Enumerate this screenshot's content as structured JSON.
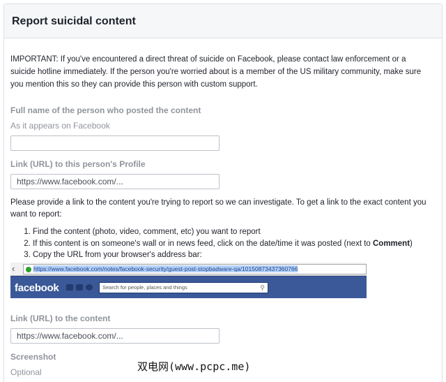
{
  "header": {
    "title": "Report suicidal content"
  },
  "notice": "IMPORTANT: If you've encountered a direct threat of suicide on Facebook, please contact law enforcement or a suicide hotline immediately. If the person you're worried about is a member of the US military community, make sure you mention this so they can provide this person with custom support.",
  "full_name": {
    "label": "Full name of the person who posted the content",
    "sublabel": "As it appears on Facebook",
    "value": "",
    "placeholder": ""
  },
  "profile_link": {
    "label": "Link (URL) to this person's Profile",
    "placeholder": "https://www.facebook.com/..."
  },
  "instructions": {
    "intro": "Please provide a link to the content you're trying to report so we can investigate. To get a link to the exact content you want to report:",
    "steps": [
      "Find the content (photo, video, comment, etc) you want to report",
      "If this content is on someone's wall or in news feed, click on the date/time it was posted (next to ",
      "Copy the URL from your browser's address bar:"
    ],
    "step2_bold": "Comment",
    "step2_end": ")"
  },
  "example_screenshot": {
    "url": "https://www.facebook.com/notes/facebook-security/guest-post-stopbadware-qa/10150873437360766",
    "logo": "facebook",
    "search_placeholder": "Search for people, places and things"
  },
  "content_link": {
    "label": "Link (URL) to the content",
    "placeholder": "https://www.facebook.com/..."
  },
  "screenshot": {
    "label": "Screenshot",
    "sublabel": "Optional"
  },
  "watermark": "双电网(www.pcpc.me)",
  "colors": {
    "label_grey": "#90949c",
    "header_bg": "#f6f7f9",
    "facebook_blue": "#3b5998"
  }
}
